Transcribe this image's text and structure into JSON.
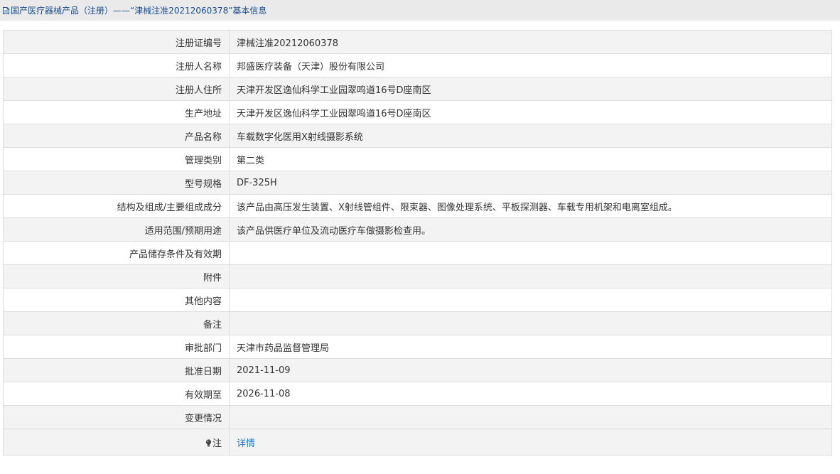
{
  "header": {
    "title": "国产医疗器械产品（注册）——“津械注准20212060378”基本信息"
  },
  "rows": [
    {
      "label": "注册证编号",
      "value": "津械注准20212060378"
    },
    {
      "label": "注册人名称",
      "value": "邦盛医疗装备（天津）股份有限公司"
    },
    {
      "label": "注册人住所",
      "value": "天津开发区逸仙科学工业园翠鸣道16号D座南区"
    },
    {
      "label": "生产地址",
      "value": "天津开发区逸仙科学工业园翠鸣道16号D座南区"
    },
    {
      "label": "产品名称",
      "value": "车载数字化医用X射线摄影系统"
    },
    {
      "label": "管理类别",
      "value": "第二类"
    },
    {
      "label": "型号规格",
      "value": "DF-325H"
    },
    {
      "label": "结构及组成/主要组成成分",
      "value": "该产品由高压发生装置、X射线管组件、限束器、图像处理系统、平板探测器、车载专用机架和电离室组成。"
    },
    {
      "label": "适用范围/预期用途",
      "value": "该产品供医疗单位及流动医疗车做摄影检查用。"
    },
    {
      "label": "产品储存条件及有效期",
      "value": ""
    },
    {
      "label": "附件",
      "value": ""
    },
    {
      "label": "其他内容",
      "value": ""
    },
    {
      "label": "备注",
      "value": ""
    },
    {
      "label": "审批部门",
      "value": "天津市药品监督管理局"
    },
    {
      "label": "批准日期",
      "value": "2021-11-09"
    },
    {
      "label": "有效期至",
      "value": "2026-11-08"
    },
    {
      "label": "变更情况",
      "value": ""
    }
  ],
  "note": {
    "label": "注",
    "icon": "lightbulb-icon",
    "link_text": "详情",
    "link_color": "#1a7ad8"
  }
}
